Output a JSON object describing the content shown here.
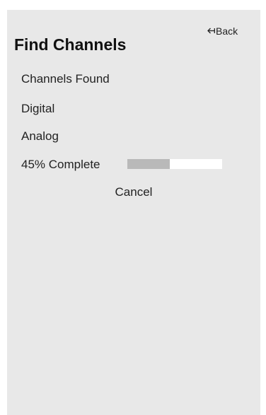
{
  "header": {
    "back_label": "Back",
    "title": "Find Channels"
  },
  "menu": {
    "channels_found": "Channels Found",
    "digital": "Digital",
    "analog": "Analog"
  },
  "progress": {
    "label": "45% Complete",
    "percent": 45
  },
  "actions": {
    "cancel_label": "Cancel"
  },
  "colors": {
    "panel_bg": "#e8e8e8",
    "progress_fill": "#b9b9b9",
    "progress_track": "#ffffff"
  }
}
